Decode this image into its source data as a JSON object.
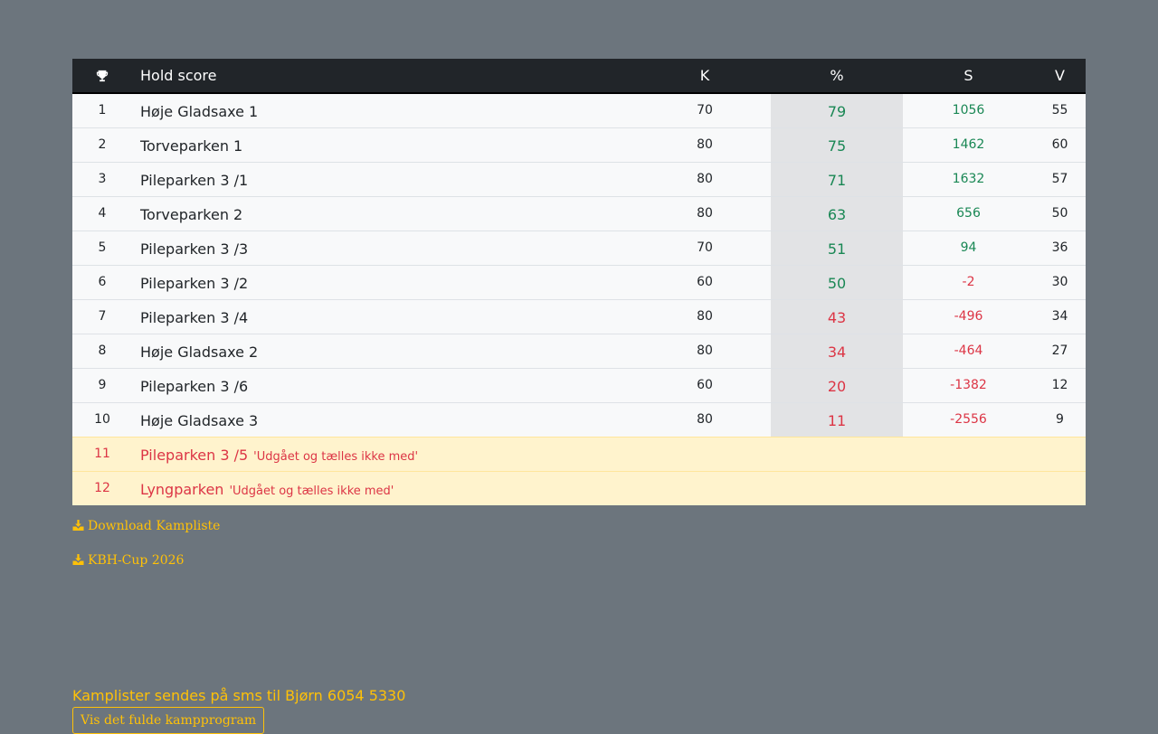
{
  "table": {
    "headers": {
      "name": "Hold score",
      "k": "K",
      "pct": "%",
      "s": "S",
      "v": "V"
    },
    "rows": [
      {
        "rank": "1",
        "name": "Høje Gladsaxe 1",
        "k": "70",
        "pct": "79",
        "s": "1056",
        "v": "55"
      },
      {
        "rank": "2",
        "name": "Torveparken 1",
        "k": "80",
        "pct": "75",
        "s": "1462",
        "v": "60"
      },
      {
        "rank": "3",
        "name": "Pileparken 3 /1",
        "k": "80",
        "pct": "71",
        "s": "1632",
        "v": "57"
      },
      {
        "rank": "4",
        "name": "Torveparken 2",
        "k": "80",
        "pct": "63",
        "s": "656",
        "v": "50"
      },
      {
        "rank": "5",
        "name": "Pileparken 3 /3",
        "k": "70",
        "pct": "51",
        "s": "94",
        "v": "36"
      },
      {
        "rank": "6",
        "name": "Pileparken 3 /2",
        "k": "60",
        "pct": "50",
        "s": "-2",
        "v": "30"
      },
      {
        "rank": "7",
        "name": "Pileparken 3 /4",
        "k": "80",
        "pct": "43",
        "s": "-496",
        "v": "34"
      },
      {
        "rank": "8",
        "name": "Høje Gladsaxe 2",
        "k": "80",
        "pct": "34",
        "s": "-464",
        "v": "27"
      },
      {
        "rank": "9",
        "name": "Pileparken 3 /6",
        "k": "60",
        "pct": "20",
        "s": "-1382",
        "v": "12"
      },
      {
        "rank": "10",
        "name": "Høje Gladsaxe 3",
        "k": "80",
        "pct": "11",
        "s": "-2556",
        "v": "9"
      }
    ],
    "withdrawn": [
      {
        "rank": "11",
        "name": "Pileparken 3 /5",
        "note": "'Udgået og tælles ikke med'"
      },
      {
        "rank": "12",
        "name": "Lyngparken",
        "note": "'Udgået og tælles ikke med'"
      }
    ]
  },
  "downloads": {
    "kampliste": "Download Kampliste",
    "cup": "KBH-Cup 2026"
  },
  "footer": {
    "sms": "Kamplister sendes på sms til Bjørn 6054 5330",
    "full_program": "Vis det fulde kampprogram"
  },
  "colors": {
    "positive": "#198754",
    "negative": "#dc3545",
    "accent": "#ffc107",
    "header_bg": "#212529",
    "page_bg": "#6c757d"
  },
  "icons": {
    "header": "trophy-icon",
    "download": "download-icon"
  }
}
